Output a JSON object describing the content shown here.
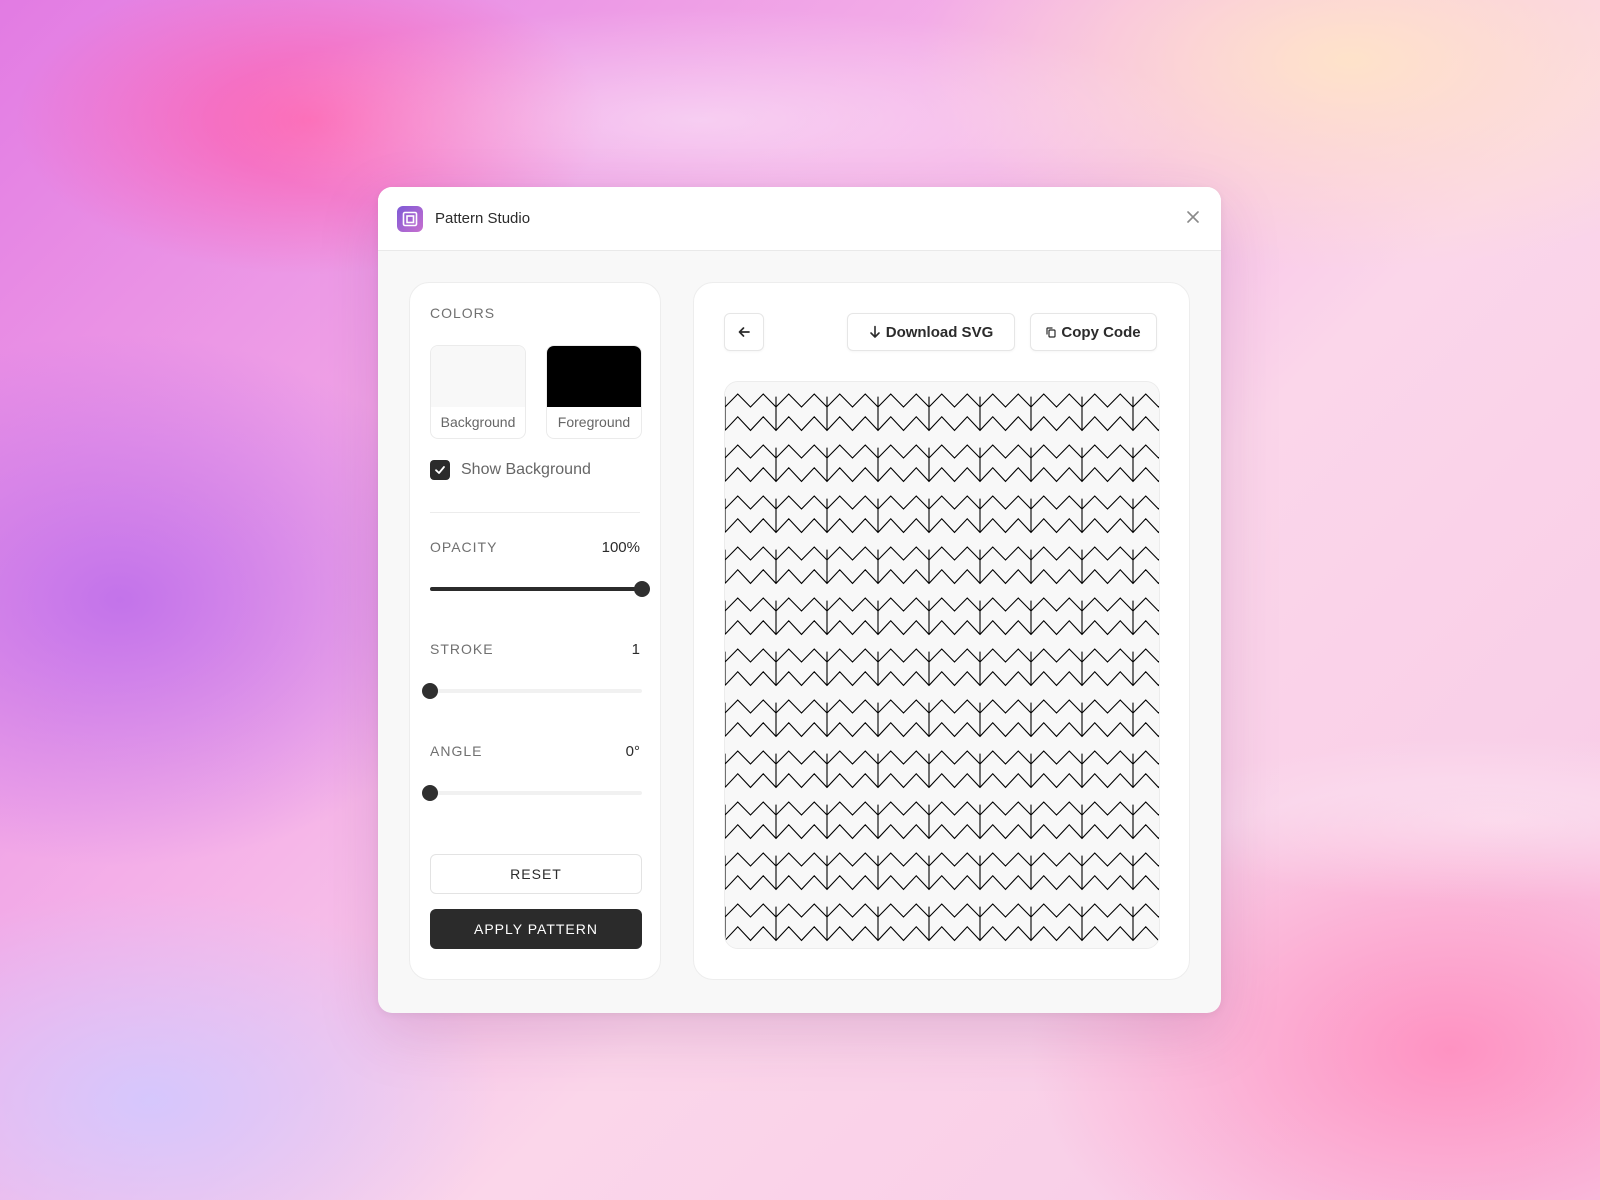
{
  "window": {
    "title": "Pattern Studio"
  },
  "sidebar": {
    "colors_label": "COLORS",
    "swatches": [
      {
        "label": "Background",
        "color": "#f8f8f8"
      },
      {
        "label": "Foreground",
        "color": "#000000"
      }
    ],
    "show_background": {
      "label": "Show Background",
      "checked": true
    },
    "sliders": [
      {
        "name": "OPACITY",
        "value": "100%",
        "fraction": 1.0
      },
      {
        "name": "STROKE",
        "value": "1",
        "fraction": 0.0
      },
      {
        "name": "ANGLE",
        "value": "0°",
        "fraction": 0.0
      }
    ],
    "reset_label": "RESET",
    "apply_label": "APPLY PATTERN"
  },
  "preview": {
    "download_label": "Download SVG",
    "copy_label": "Copy Code",
    "pattern": {
      "type": "zigzag",
      "stroke_color": "#000000",
      "background_color": "#f8f8f8"
    }
  },
  "colors": {
    "accent_dark": "#2b2b2b",
    "logo_gradient": [
      "#7d5ad6",
      "#c86fcf"
    ]
  }
}
